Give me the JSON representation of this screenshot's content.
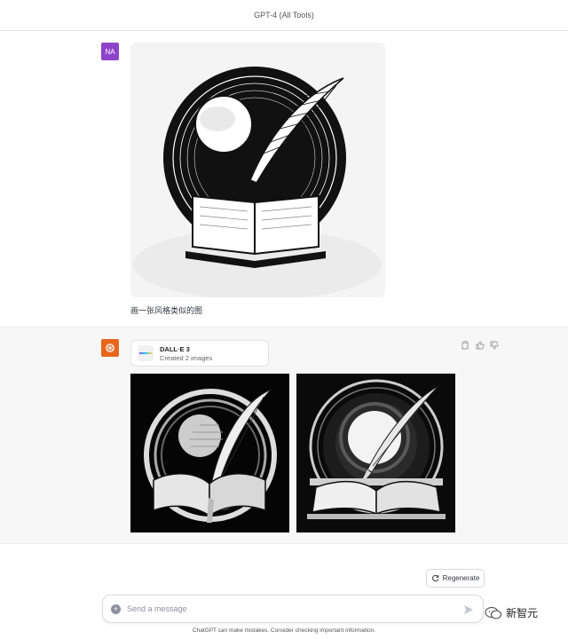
{
  "header": {
    "model_title": "GPT-4 (All Tools)"
  },
  "user_message": {
    "avatar_initials": "NA",
    "text": "画一张风格类似的图"
  },
  "assistant_message": {
    "tool": {
      "name": "DALL·E 3",
      "status": "Created 2 images"
    },
    "actions": [
      "copy-icon",
      "thumbs-up-icon",
      "thumbs-down-icon"
    ]
  },
  "controls": {
    "regenerate_label": "Regenerate",
    "composer_placeholder": "Send a message",
    "disclaimer": "ChatGPT can make mistakes. Consider checking important information."
  },
  "watermark": {
    "text": "新智元"
  }
}
